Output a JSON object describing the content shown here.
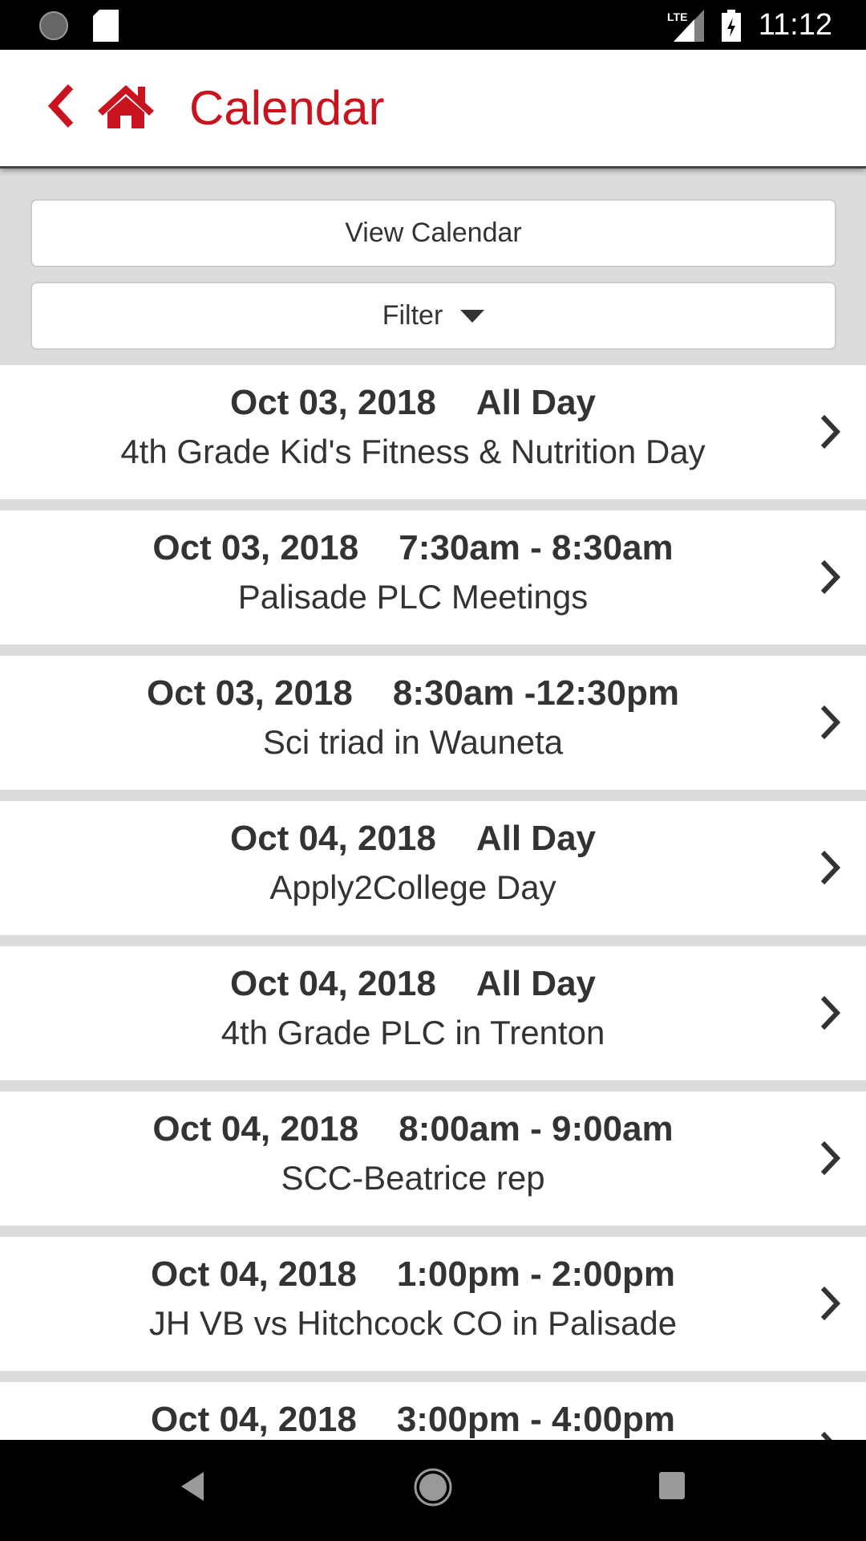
{
  "status_bar": {
    "time": "11:12",
    "network": "LTE"
  },
  "header": {
    "title": "Calendar",
    "accent": "#c8141e"
  },
  "controls": {
    "view_calendar": "View Calendar",
    "filter": "Filter"
  },
  "events": [
    {
      "date": "Oct 03, 2018",
      "time": "All Day",
      "title": "4th Grade Kid's Fitness & Nutrition Day"
    },
    {
      "date": "Oct 03, 2018",
      "time": "7:30am - 8:30am",
      "title": "Palisade PLC Meetings"
    },
    {
      "date": "Oct 03, 2018",
      "time": "8:30am -12:30pm",
      "title": "Sci triad in Wauneta"
    },
    {
      "date": "Oct 04, 2018",
      "time": "All Day",
      "title": "Apply2College Day"
    },
    {
      "date": "Oct 04, 2018",
      "time": "All Day",
      "title": "4th Grade PLC in Trenton"
    },
    {
      "date": "Oct 04, 2018",
      "time": "8:00am - 9:00am",
      "title": "SCC-Beatrice rep"
    },
    {
      "date": "Oct 04, 2018",
      "time": "1:00pm - 2:00pm",
      "title": "JH VB vs Hitchcock CO in Palisade"
    },
    {
      "date": "Oct 04, 2018",
      "time": "3:00pm - 4:00pm",
      "title": ""
    }
  ]
}
